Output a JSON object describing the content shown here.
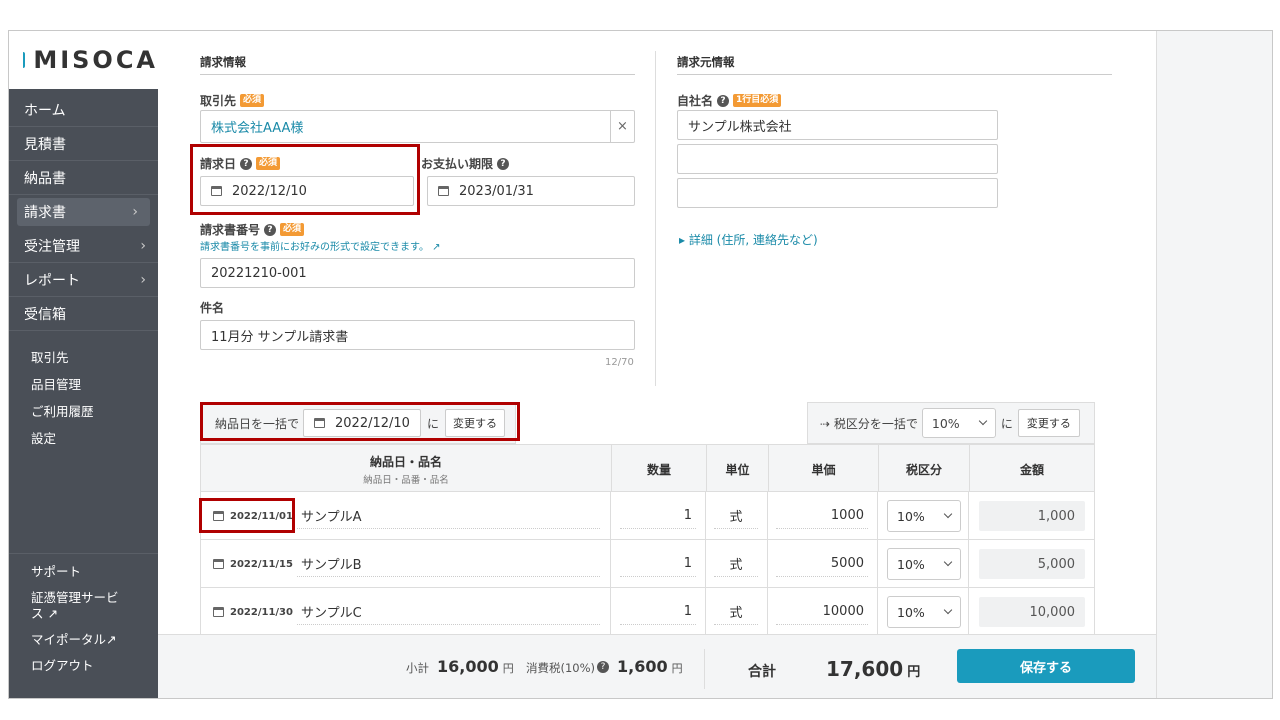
{
  "brand": {
    "name": "MISOCA"
  },
  "sidebar": {
    "items": [
      {
        "label": "ホーム",
        "chevron": ""
      },
      {
        "label": "見積書",
        "chevron": ""
      },
      {
        "label": "納品書",
        "chevron": ""
      },
      {
        "label": "請求書",
        "chevron": "›"
      },
      {
        "label": "受注管理",
        "chevron": "›"
      },
      {
        "label": "レポート",
        "chevron": "›"
      },
      {
        "label": "受信箱",
        "chevron": ""
      }
    ],
    "sub_items": [
      "取引先",
      "品目管理",
      "ご利用履歴",
      "設定"
    ],
    "bottom_items": [
      "サポート",
      "証憑管理サービス ↗",
      "マイポータル↗",
      "ログアウト"
    ]
  },
  "invoice_info": {
    "title": "請求情報",
    "client_label": "取引先",
    "required_badge": "必須",
    "client_value": "株式会社AAA様",
    "clear_glyph": "×",
    "date_label": "請求日",
    "date_value": "2022/12/10",
    "due_label": "お支払い期限",
    "due_value": "2023/01/31",
    "number_label": "請求書番号",
    "number_hint": "請求書番号を事前にお好みの形式で設定できます。 ↗",
    "number_value": "20221210-001",
    "subject_label": "件名",
    "subject_value": "11月分 サンプル請求書",
    "subject_counter": "12/70"
  },
  "issuer_info": {
    "title": "請求元情報",
    "company_label": "自社名",
    "first_line_required": "1行目必須",
    "company_line1": "サンプル株式会社",
    "company_line2": "",
    "company_line3": "",
    "details_link": "▸ 詳細 (住所, 連絡先など)"
  },
  "bulk_delivery": {
    "label": "納品日を一括で",
    "date_value": "2022/12/10",
    "suffix": "に",
    "button": "変更する"
  },
  "bulk_tax": {
    "label": "⇢ 税区分を一括で",
    "rate_value": "10%",
    "suffix": "に",
    "button": "変更する"
  },
  "table": {
    "headers": {
      "item": "納品日・品名",
      "item_sub": "納品日・品番・品名",
      "qty": "数量",
      "unit": "単位",
      "price": "単価",
      "tax": "税区分",
      "amount": "金額"
    },
    "rows": [
      {
        "date": "2022/11/01",
        "name": "サンプルA",
        "qty": "1",
        "unit": "式",
        "price": "1000",
        "tax": "10%",
        "amount": "1,000"
      },
      {
        "date": "2022/11/15",
        "name": "サンプルB",
        "qty": "1",
        "unit": "式",
        "price": "5000",
        "tax": "10%",
        "amount": "5,000"
      },
      {
        "date": "2022/11/30",
        "name": "サンプルC",
        "qty": "1",
        "unit": "式",
        "price": "10000",
        "tax": "10%",
        "amount": "10,000"
      }
    ]
  },
  "footer": {
    "subtotal_label": "小計",
    "subtotal_value": "16,000",
    "tax_label": "消費税(10%)",
    "tax_value": "1,600",
    "unit": "円",
    "total_label": "合計",
    "total_value": "17,600",
    "save_button": "保存する"
  },
  "colors": {
    "accent": "#1a9bbd",
    "sidebar": "#4a4f57",
    "required": "#f39a34",
    "highlight": "#b00000"
  }
}
